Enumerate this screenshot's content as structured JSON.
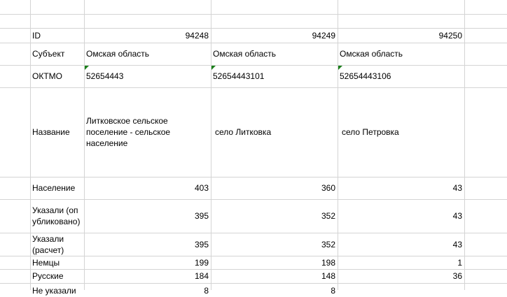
{
  "rows": {
    "id": {
      "label": "ID",
      "values": [
        "94248",
        "94249",
        "94250"
      ]
    },
    "subject": {
      "label": "Субъект",
      "values": [
        "Омская область",
        "Омская область",
        "Омская область"
      ]
    },
    "oktmo": {
      "label": "ОКТМО",
      "values": [
        "52654443",
        "52654443101",
        "52654443106"
      ]
    },
    "name": {
      "label": "Название",
      "values": [
        "Литковское сельское поселение - сельское население",
        "село Литковка",
        "село Петровка"
      ]
    },
    "population": {
      "label": "Население",
      "values": [
        "403",
        "360",
        "43"
      ]
    },
    "indicated_published": {
      "label": "Указали (опубликовано)",
      "values": [
        "395",
        "352",
        "43"
      ]
    },
    "indicated_calc": {
      "label": "Указали (расчет)",
      "values": [
        "395",
        "352",
        "43"
      ]
    },
    "germans": {
      "label": "Немцы",
      "values": [
        "199",
        "198",
        "1"
      ]
    },
    "russians": {
      "label": "Русские",
      "values": [
        "184",
        "148",
        "36"
      ]
    },
    "not_indicated": {
      "label": "Не указали",
      "values": [
        "8",
        "8",
        ""
      ]
    }
  },
  "colors": {
    "gridline": "#d4d4d4",
    "comment_marker": "#1a7f1a"
  }
}
